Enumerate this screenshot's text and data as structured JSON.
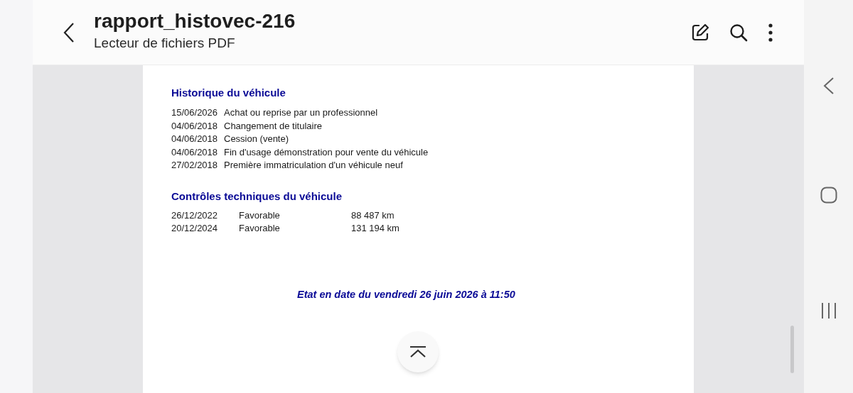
{
  "header": {
    "title": "rapport_histovec-216",
    "subtitle": "Lecteur de fichiers PDF"
  },
  "document": {
    "history": {
      "heading": "Historique du véhicule",
      "rows": [
        {
          "date": "15/06/2026",
          "event": "Achat ou reprise par un professionnel"
        },
        {
          "date": "04/06/2018",
          "event": "Changement de titulaire"
        },
        {
          "date": "04/06/2018",
          "event": "Cession (vente)"
        },
        {
          "date": "04/06/2018",
          "event": "Fin d'usage démonstration pour vente du véhicule"
        },
        {
          "date": "27/02/2018",
          "event": "Première immatriculation d'un véhicule neuf"
        }
      ]
    },
    "inspections": {
      "heading": "Contrôles techniques du véhicule",
      "rows": [
        {
          "date": "26/12/2022",
          "result": "Favorable",
          "mileage": "88 487 km"
        },
        {
          "date": "20/12/2024",
          "result": "Favorable",
          "mileage": "131 194 km"
        }
      ]
    },
    "footer": "Etat en date du vendredi 26 juin 2026 à 11:50"
  }
}
